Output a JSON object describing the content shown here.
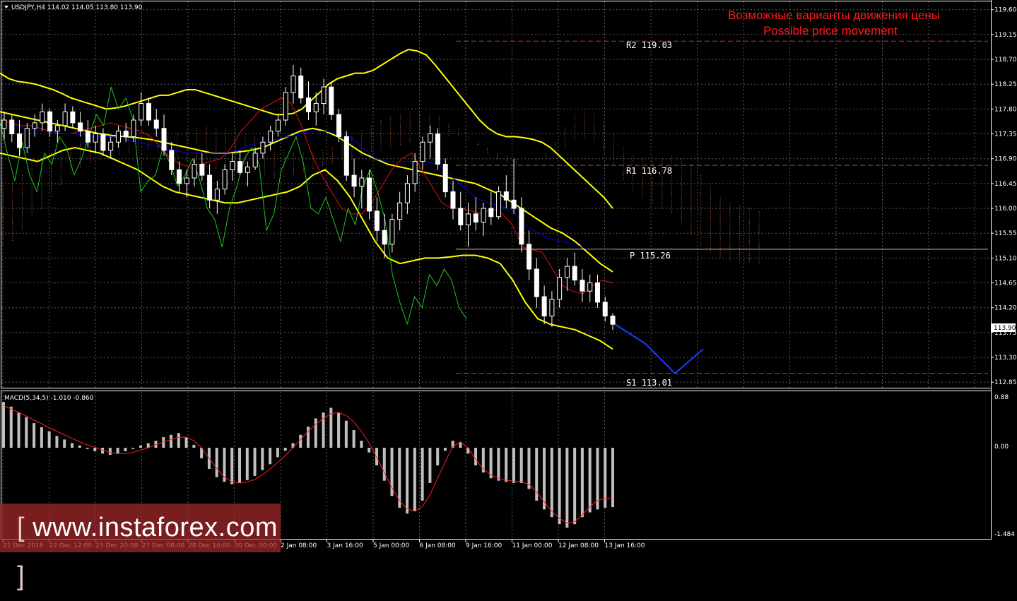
{
  "header": {
    "symbol_line": "USDJPY,H4  114.02 114.05 113.80 113.90",
    "triangle_icon": "dropdown-triangle-icon"
  },
  "annotation": {
    "title_ru": "Возможные варианты движения цены",
    "title_en": "Possible price movement",
    "color": "#ff1a1a"
  },
  "levels": [
    {
      "name": "R2",
      "text": "R2 119.03",
      "value": 119.03,
      "color": "#c83c28",
      "style": "dashed"
    },
    {
      "name": "R1",
      "text": "R1 116.78",
      "value": 116.78,
      "color": "#c83c28",
      "style": "dashed"
    },
    {
      "name": "P",
      "text": "P 115.26",
      "value": 115.26,
      "color": "#e8b890",
      "style": "solid"
    },
    {
      "name": "S1",
      "text": "S1 113.01",
      "value": 113.01,
      "color": "#c83c28",
      "style": "dashed"
    }
  ],
  "price_axis": {
    "ticks": [
      "119.60",
      "119.15",
      "118.70",
      "118.25",
      "117.80",
      "117.35",
      "116.90",
      "116.45",
      "116.00",
      "115.55",
      "115.10",
      "114.65",
      "114.20",
      "113.75",
      "113.30",
      "112.85"
    ],
    "current_price": "113.90"
  },
  "macd": {
    "label": "MACD(5,34,5) -1.010 -0.860",
    "ticks": [
      "0.88",
      "0.00",
      "-1.484"
    ],
    "hist_color": "#c0c0c0",
    "signal_color": "#ff2020"
  },
  "time_axis": [
    "21 Dec 2016",
    "22 Dec 12:00",
    "23 Dec 20:00",
    "27 Dec 08:00",
    "28 Dec 16:00",
    "30 Dec 00:00",
    "2 Jan 08:00",
    "3 Jan 16:00",
    "5 Jan 00:00",
    "6 Jan 08:00",
    "9 Jan 16:00",
    "11 Jan 00:00",
    "12 Jan 08:00",
    "13 Jan 16:00"
  ],
  "watermark": {
    "text_open": "[",
    "text": " www.instaforex.com ",
    "text_close": "]"
  },
  "chart_data": {
    "type": "line",
    "title": "USDJPY,H4",
    "ylim": [
      112.75,
      119.75
    ],
    "macd_ylim": [
      -1.55,
      0.95
    ],
    "grid": true,
    "candles": [
      [
        117.45,
        117.75,
        117.25,
        117.6
      ],
      [
        117.6,
        117.7,
        117.2,
        117.35
      ],
      [
        117.35,
        117.6,
        116.95,
        117.1
      ],
      [
        117.1,
        117.55,
        117.0,
        117.45
      ],
      [
        117.45,
        117.7,
        117.3,
        117.55
      ],
      [
        117.55,
        117.9,
        117.4,
        117.75
      ],
      [
        117.75,
        117.8,
        117.3,
        117.4
      ],
      [
        117.4,
        117.6,
        117.2,
        117.5
      ],
      [
        117.5,
        117.9,
        117.4,
        117.75
      ],
      [
        117.75,
        117.85,
        117.45,
        117.55
      ],
      [
        117.55,
        117.75,
        117.3,
        117.4
      ],
      [
        117.4,
        117.6,
        117.1,
        117.2
      ],
      [
        117.2,
        117.5,
        117.0,
        117.35
      ],
      [
        117.35,
        117.45,
        116.95,
        117.05
      ],
      [
        117.05,
        117.3,
        116.9,
        117.2
      ],
      [
        117.2,
        117.5,
        117.1,
        117.4
      ],
      [
        117.4,
        117.55,
        117.2,
        117.3
      ],
      [
        117.3,
        117.7,
        117.2,
        117.6
      ],
      [
        117.6,
        118.1,
        117.5,
        117.9
      ],
      [
        117.9,
        118.0,
        117.5,
        117.6
      ],
      [
        117.6,
        117.8,
        117.3,
        117.45
      ],
      [
        117.45,
        117.7,
        116.95,
        117.05
      ],
      [
        117.05,
        117.2,
        116.6,
        116.7
      ],
      [
        116.7,
        116.85,
        116.3,
        116.45
      ],
      [
        116.45,
        116.7,
        116.2,
        116.55
      ],
      [
        116.55,
        116.9,
        116.4,
        116.8
      ],
      [
        116.8,
        117.0,
        116.5,
        116.6
      ],
      [
        116.6,
        116.8,
        116.0,
        116.15
      ],
      [
        116.15,
        116.5,
        115.9,
        116.35
      ],
      [
        116.35,
        116.8,
        116.25,
        116.7
      ],
      [
        116.7,
        117.0,
        116.5,
        116.85
      ],
      [
        116.85,
        117.05,
        116.6,
        116.65
      ],
      [
        116.65,
        116.85,
        116.4,
        116.75
      ],
      [
        116.75,
        117.1,
        116.7,
        117.0
      ],
      [
        117.0,
        117.3,
        116.9,
        117.2
      ],
      [
        117.2,
        117.5,
        117.05,
        117.4
      ],
      [
        117.4,
        117.7,
        117.3,
        117.6
      ],
      [
        117.6,
        118.2,
        117.5,
        118.1
      ],
      [
        118.1,
        118.6,
        117.9,
        118.4
      ],
      [
        118.4,
        118.55,
        117.9,
        118.0
      ],
      [
        118.0,
        118.3,
        117.6,
        117.75
      ],
      [
        117.75,
        118.1,
        117.5,
        117.9
      ],
      [
        117.9,
        118.35,
        117.7,
        118.2
      ],
      [
        118.2,
        118.3,
        117.6,
        117.7
      ],
      [
        117.7,
        117.8,
        117.2,
        117.3
      ],
      [
        117.3,
        117.4,
        116.5,
        116.6
      ],
      [
        116.6,
        116.9,
        116.2,
        116.4
      ],
      [
        116.4,
        116.7,
        116.0,
        116.55
      ],
      [
        116.55,
        116.7,
        115.8,
        115.95
      ],
      [
        115.95,
        116.2,
        115.4,
        115.6
      ],
      [
        115.6,
        115.9,
        115.1,
        115.35
      ],
      [
        115.35,
        115.9,
        115.2,
        115.8
      ],
      [
        115.8,
        116.3,
        115.6,
        116.1
      ],
      [
        116.1,
        116.6,
        115.9,
        116.45
      ],
      [
        116.45,
        117.0,
        116.3,
        116.85
      ],
      [
        116.85,
        117.3,
        116.7,
        117.2
      ],
      [
        117.2,
        117.5,
        116.9,
        117.35
      ],
      [
        117.35,
        117.45,
        116.7,
        116.8
      ],
      [
        116.8,
        116.9,
        116.2,
        116.3
      ],
      [
        116.3,
        116.5,
        115.8,
        116.0
      ],
      [
        116.0,
        116.3,
        115.6,
        115.7
      ],
      [
        115.7,
        116.1,
        115.3,
        115.9
      ],
      [
        115.9,
        116.2,
        115.6,
        115.75
      ],
      [
        115.75,
        116.1,
        115.5,
        116.0
      ],
      [
        116.0,
        116.3,
        115.7,
        115.85
      ],
      [
        115.85,
        116.4,
        115.8,
        116.3
      ],
      [
        116.3,
        116.6,
        116.0,
        116.15
      ],
      [
        116.15,
        116.9,
        115.9,
        116.0
      ],
      [
        116.0,
        116.2,
        115.2,
        115.35
      ],
      [
        115.35,
        115.6,
        114.7,
        114.9
      ],
      [
        114.9,
        115.1,
        114.2,
        114.4
      ],
      [
        114.4,
        114.6,
        113.9,
        114.05
      ],
      [
        114.05,
        114.5,
        113.85,
        114.35
      ],
      [
        114.35,
        114.9,
        114.2,
        114.75
      ],
      [
        114.75,
        115.1,
        114.5,
        114.95
      ],
      [
        114.95,
        115.2,
        114.6,
        114.7
      ],
      [
        114.7,
        114.9,
        114.3,
        114.5
      ],
      [
        114.5,
        114.8,
        114.3,
        114.65
      ],
      [
        114.65,
        114.8,
        114.2,
        114.3
      ],
      [
        114.3,
        114.4,
        113.95,
        114.05
      ],
      [
        114.05,
        114.1,
        113.8,
        113.9
      ]
    ],
    "series": [
      {
        "name": "bb_upper",
        "color": "#ffff00",
        "width": 2,
        "values": [
          118.45,
          118.35,
          118.3,
          118.28,
          118.25,
          118.2,
          118.15,
          118.08,
          118.0,
          117.95,
          117.9,
          117.85,
          117.8,
          117.82,
          117.85,
          117.9,
          117.95,
          118.0,
          118.05,
          118.05,
          118.1,
          118.15,
          118.15,
          118.1,
          118.05,
          118.0,
          117.95,
          117.9,
          117.85,
          117.8,
          117.75,
          117.7,
          117.7,
          117.72,
          117.8,
          117.95,
          118.1,
          118.25,
          118.35,
          118.4,
          118.45,
          118.45,
          118.5,
          118.6,
          118.7,
          118.8,
          118.88,
          118.85,
          118.78,
          118.6,
          118.4,
          118.2,
          118.0,
          117.8,
          117.6,
          117.45,
          117.35,
          117.3,
          117.3,
          117.28,
          117.25,
          117.2,
          117.1,
          116.95,
          116.8,
          116.65,
          116.5,
          116.35,
          116.2,
          116.0
        ]
      },
      {
        "name": "bb_middle",
        "color": "#ffff00",
        "width": 2,
        "values": [
          117.75,
          117.7,
          117.65,
          117.6,
          117.55,
          117.5,
          117.45,
          117.4,
          117.35,
          117.32,
          117.3,
          117.28,
          117.25,
          117.2,
          117.15,
          117.1,
          117.05,
          117.0,
          117.0,
          117.02,
          117.05,
          117.1,
          117.2,
          117.3,
          117.4,
          117.45,
          117.4,
          117.3,
          117.15,
          117.0,
          116.9,
          116.8,
          116.75,
          116.7,
          116.65,
          116.6,
          116.55,
          116.5,
          116.45,
          116.35,
          116.25,
          116.1,
          115.95,
          115.8,
          115.65,
          115.55,
          115.4,
          115.2,
          115.0,
          114.85
        ]
      },
      {
        "name": "bb_lower",
        "color": "#ffff00",
        "width": 2,
        "values": [
          117.0,
          116.95,
          116.9,
          116.85,
          116.95,
          117.05,
          117.1,
          117.05,
          117.0,
          116.9,
          116.8,
          116.7,
          116.55,
          116.4,
          116.3,
          116.25,
          116.2,
          116.15,
          116.1,
          116.1,
          116.15,
          116.2,
          116.25,
          116.3,
          116.4,
          116.6,
          116.7,
          116.5,
          116.2,
          115.8,
          115.4,
          115.1,
          115.0,
          115.05,
          115.1,
          115.1,
          115.12,
          115.15,
          115.15,
          115.1,
          115.0,
          114.7,
          114.3,
          114.0,
          113.9,
          113.85,
          113.8,
          113.7,
          113.6,
          113.45
        ]
      },
      {
        "name": "tenkan",
        "color": "#e01010",
        "width": 1,
        "values": [
          117.6,
          117.55,
          117.5,
          117.5,
          117.45,
          117.4,
          117.35,
          117.35,
          117.4,
          117.45,
          117.5,
          117.55,
          117.5,
          117.45,
          117.4,
          117.3,
          117.1,
          116.9,
          116.8,
          116.75,
          116.8,
          116.85,
          116.9,
          117.1,
          117.4,
          117.6,
          117.8,
          117.9,
          118.0,
          117.9,
          117.5,
          117.0,
          116.6,
          116.3,
          116.0,
          115.9,
          115.9,
          116.1,
          116.4,
          116.7,
          116.9,
          117.0,
          116.7,
          116.4,
          116.1,
          116.0,
          116.0,
          115.95,
          115.9,
          116.0,
          115.9,
          115.7,
          115.3,
          115.25,
          115.2,
          114.9,
          114.6,
          114.5,
          114.45,
          114.6,
          114.7,
          114.65
        ]
      },
      {
        "name": "kijun",
        "color": "#0000e0",
        "width": 1,
        "values": [
          117.5,
          117.5,
          117.45,
          117.4,
          117.4,
          117.35,
          117.35,
          117.3,
          117.3,
          117.3,
          117.25,
          117.2,
          117.15,
          117.1,
          117.05,
          117.0,
          117.0,
          117.0,
          117.0,
          117.05,
          117.15,
          117.2,
          117.25,
          117.3,
          117.35,
          117.4,
          117.4,
          117.35,
          117.3,
          117.1,
          116.9,
          116.85,
          116.85,
          116.85,
          116.85,
          116.8,
          116.6,
          116.4,
          116.2,
          116.1,
          116.05,
          115.95,
          115.7,
          115.55,
          115.45,
          115.4,
          115.35,
          115.25,
          115.25,
          115.25
        ]
      },
      {
        "name": "chikou",
        "color": "#1ec81e",
        "width": 1,
        "values": [
          117.55,
          117.0,
          116.5,
          117.2,
          116.6,
          116.3,
          117.0,
          116.8,
          117.3,
          117.1,
          116.6,
          116.9,
          117.3,
          117.7,
          117.5,
          118.2,
          117.8,
          118.0,
          117.6,
          116.3,
          116.5,
          116.6,
          117.1,
          116.8,
          116.4,
          116.6,
          116.9,
          116.5,
          116.0,
          115.8,
          115.3,
          116.0,
          116.4,
          116.9,
          117.1,
          116.8,
          115.6,
          115.9,
          116.7,
          117.0,
          117.3,
          116.8,
          116.0,
          115.9,
          116.2,
          115.8,
          115.4,
          116.0,
          115.7,
          116.4,
          116.7,
          116.3,
          115.8,
          114.8,
          114.3,
          113.9,
          114.4,
          114.2,
          114.8,
          114.6,
          114.9,
          114.7,
          114.2,
          114.0
        ]
      },
      {
        "name": "forecast",
        "color": "#1a3cff",
        "width": 2,
        "x_values": [
          0,
          1,
          2,
          3
        ],
        "values": [
          113.9,
          113.55,
          113.01,
          113.45
        ]
      }
    ],
    "macd_hist": [
      0.78,
      0.7,
      0.6,
      0.52,
      0.42,
      0.35,
      0.28,
      0.2,
      0.14,
      0.08,
      0.04,
      -0.02,
      -0.06,
      -0.1,
      -0.12,
      -0.1,
      -0.06,
      -0.02,
      0.04,
      0.08,
      0.12,
      0.18,
      0.22,
      0.25,
      0.18,
      0.05,
      -0.18,
      -0.36,
      -0.5,
      -0.58,
      -0.62,
      -0.6,
      -0.55,
      -0.48,
      -0.38,
      -0.28,
      -0.16,
      -0.05,
      0.08,
      0.22,
      0.36,
      0.5,
      0.6,
      0.68,
      0.6,
      0.46,
      0.3,
      0.12,
      -0.08,
      -0.3,
      -0.56,
      -0.82,
      -1.02,
      -1.12,
      -1.08,
      -0.9,
      -0.6,
      -0.3,
      -0.05,
      0.12,
      0.1,
      -0.1,
      -0.3,
      -0.42,
      -0.52,
      -0.56,
      -0.58,
      -0.6,
      -0.6,
      -0.7,
      -0.9,
      -1.05,
      -1.18,
      -1.3,
      -1.36,
      -1.3,
      -1.18,
      -1.1,
      -1.05,
      -1.02,
      -1.01
    ],
    "macd_signal": [
      0.72,
      0.66,
      0.6,
      0.54,
      0.47,
      0.41,
      0.34,
      0.28,
      0.22,
      0.16,
      0.1,
      0.05,
      0.01,
      -0.04,
      -0.08,
      -0.1,
      -0.1,
      -0.08,
      -0.04,
      0.0,
      0.05,
      0.1,
      0.14,
      0.18,
      0.18,
      0.12,
      0.0,
      -0.18,
      -0.35,
      -0.5,
      -0.58,
      -0.6,
      -0.58,
      -0.54,
      -0.46,
      -0.36,
      -0.25,
      -0.13,
      0.0,
      0.14,
      0.28,
      0.4,
      0.5,
      0.58,
      0.6,
      0.55,
      0.44,
      0.28,
      0.08,
      -0.16,
      -0.42,
      -0.68,
      -0.9,
      -1.04,
      -1.08,
      -1.0,
      -0.8,
      -0.52,
      -0.24,
      0.02,
      0.1,
      0.0,
      -0.2,
      -0.36,
      -0.46,
      -0.52,
      -0.55,
      -0.57,
      -0.58,
      -0.62,
      -0.75,
      -0.92,
      -1.08,
      -1.2,
      -1.28,
      -1.26,
      -1.14,
      -1.0,
      -0.9,
      -0.86,
      -0.86
    ]
  }
}
